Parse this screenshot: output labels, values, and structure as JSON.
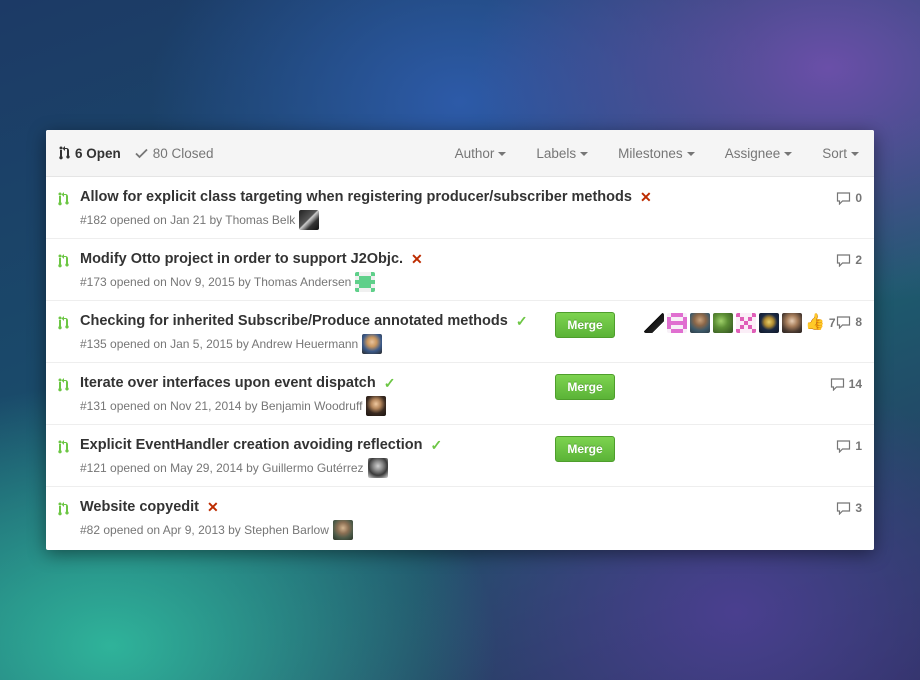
{
  "header": {
    "open_label": "6 Open",
    "closed_label": "80 Closed",
    "filters": [
      "Author",
      "Labels",
      "Milestones",
      "Assignee",
      "Sort"
    ]
  },
  "pulls": [
    {
      "title": "Allow for explicit class targeting when registering producer/subscriber methods",
      "status": "fail",
      "meta": "#182 opened on Jan 21 by Thomas Belk",
      "comments": "0"
    },
    {
      "title": "Modify Otto project in order to support J2Objc.",
      "status": "fail",
      "meta": "#173 opened on Nov 9, 2015 by Thomas Andersen",
      "comments": "2"
    },
    {
      "title": "Checking for inherited Subscribe/Produce annotated methods",
      "status": "ok",
      "meta": "#135 opened on Jan 5, 2015 by Andrew Heuermann",
      "comments": "8",
      "merge": "Merge",
      "participants_count": "7"
    },
    {
      "title": "Iterate over interfaces upon event dispatch",
      "status": "ok",
      "meta": "#131 opened on Nov 21, 2014 by Benjamin Woodruff",
      "comments": "14",
      "merge": "Merge"
    },
    {
      "title": "Explicit EventHandler creation avoiding reflection",
      "status": "ok",
      "meta": "#121 opened on May 29, 2014 by Guillermo Gutérrez",
      "comments": "1",
      "merge": "Merge"
    },
    {
      "title": "Website copyedit",
      "status": "fail",
      "meta": "#82 opened on Apr 9, 2013 by Stephen Barlow",
      "comments": "3"
    }
  ],
  "status_glyphs": {
    "fail": "✕",
    "ok": "✓"
  },
  "colors": {
    "open_icon": "#6cc644",
    "fail": "#bd2c00",
    "ok": "#6cc644",
    "merge": "#6cc644"
  }
}
